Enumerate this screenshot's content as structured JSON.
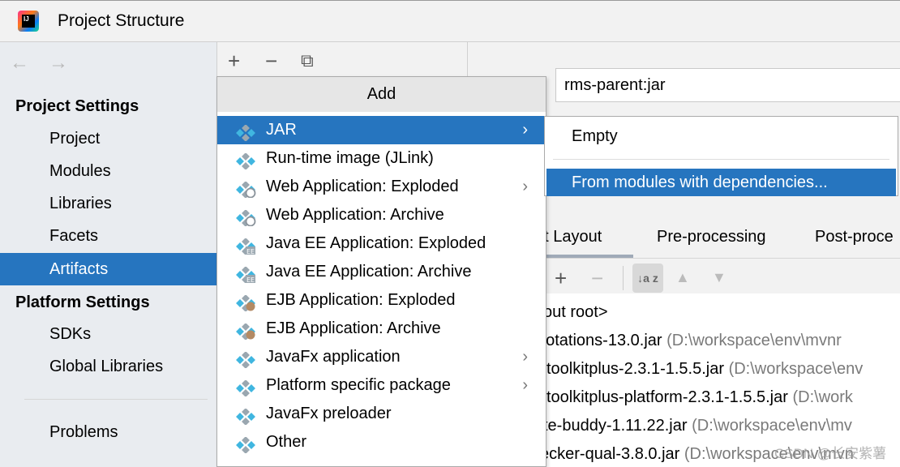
{
  "window": {
    "title": "Project Structure",
    "logo_text": "IJ"
  },
  "nav": {
    "back": "←",
    "forward": "→"
  },
  "sidebar": {
    "project_settings": "Project Settings",
    "project_items": [
      {
        "label": "Project"
      },
      {
        "label": "Modules"
      },
      {
        "label": "Libraries"
      },
      {
        "label": "Facets"
      },
      {
        "label": "Artifacts",
        "selected": true
      }
    ],
    "platform_settings": "Platform Settings",
    "platform_items": [
      {
        "label": "SDKs"
      },
      {
        "label": "Global Libraries"
      }
    ],
    "problems": "Problems"
  },
  "toolbar": {
    "add": "+",
    "remove": "−",
    "copy": "⧉"
  },
  "artifact": {
    "name": "rms-parent:jar"
  },
  "tabs": [
    {
      "label": "ut Layout",
      "active": true
    },
    {
      "label": "Pre-processing"
    },
    {
      "label": "Post-proce"
    }
  ],
  "layout_toolbar": {
    "add": "+",
    "remove": "−",
    "sort": "↓a z",
    "up": "▲",
    "down": "▼"
  },
  "tree": [
    {
      "name": "out root>",
      "path": ""
    },
    {
      "name": "notations-13.0.jar",
      "path": "(D:\\workspace\\env\\mvnr"
    },
    {
      "name": "toolkitplus-2.3.1-1.5.5.jar",
      "path": "(D:\\workspace\\env"
    },
    {
      "name": "toolkitplus-platform-2.3.1-1.5.5.jar",
      "path": "(D:\\work"
    },
    {
      "name": "te-buddy-1.11.22.jar",
      "path": "(D:\\workspace\\env\\mv"
    },
    {
      "name": "ecker-qual-3.8.0.jar",
      "path": "(D:\\workspace\\env\\mvn"
    }
  ],
  "add_menu": {
    "header": "Add",
    "items": [
      {
        "label": "JAR",
        "icon": "jar-icon",
        "submenu": true,
        "selected": true
      },
      {
        "label": "Run-time image (JLink)",
        "icon": "jar-icon"
      },
      {
        "label": "Web Application: Exploded",
        "icon": "web-app-icon",
        "submenu": true
      },
      {
        "label": "Web Application: Archive",
        "icon": "web-app-icon"
      },
      {
        "label": "Java EE Application: Exploded",
        "icon": "javaee-icon"
      },
      {
        "label": "Java EE Application: Archive",
        "icon": "javaee-icon"
      },
      {
        "label": "EJB Application: Exploded",
        "icon": "ejb-icon"
      },
      {
        "label": "EJB Application: Archive",
        "icon": "ejb-icon"
      },
      {
        "label": "JavaFx application",
        "icon": "jar-icon",
        "submenu": true
      },
      {
        "label": "Platform specific package",
        "icon": "jar-icon",
        "submenu": true
      },
      {
        "label": "JavaFx preloader",
        "icon": "jar-icon"
      },
      {
        "label": "Other",
        "icon": "jar-icon"
      }
    ]
  },
  "jar_submenu": {
    "items": [
      {
        "label": "Empty"
      },
      {
        "label": "From modules with dependencies...",
        "selected": true
      }
    ]
  },
  "watermark": "CSDN @长安紫薯",
  "colors": {
    "selection": "#2675bf",
    "diamond_blue": "#40b6e0",
    "diamond_gray": "#9aa7b0"
  }
}
